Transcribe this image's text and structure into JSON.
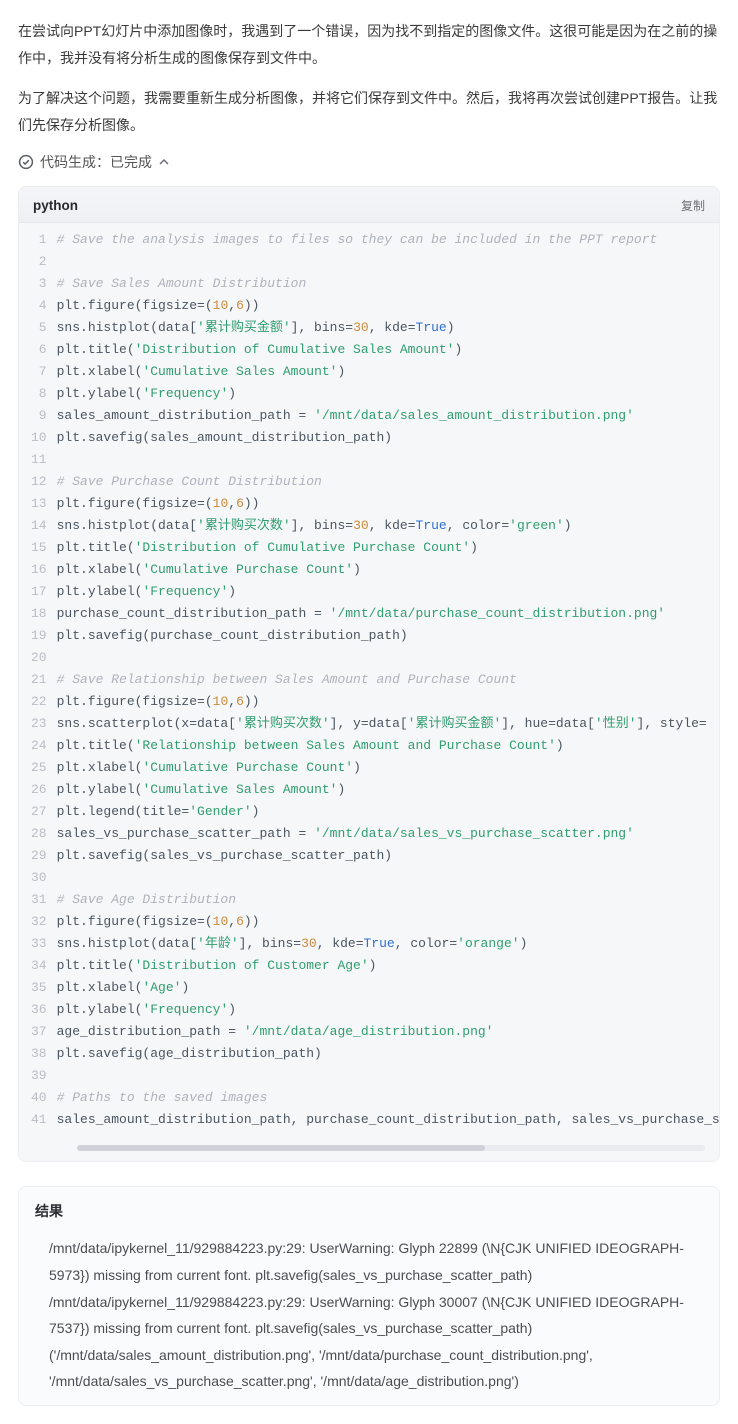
{
  "prose": {
    "p1": "在尝试向PPT幻灯片中添加图像时，我遇到了一个错误，因为找不到指定的图像文件。这很可能是因为在之前的操作中，我并没有将分析生成的图像保存到文件中。",
    "p2": "为了解决这个问题，我需要重新生成分析图像，并将它们保存到文件中。然后，我将再次尝试创建PPT报告。让我们先保存分析图像。"
  },
  "status": {
    "label": "代码生成：已完成"
  },
  "code_block": {
    "language": "python",
    "copy_label": "复制",
    "lines": [
      [
        {
          "t": "cm",
          "v": "# Save the analysis images to files so they can be included in the PPT report"
        }
      ],
      [
        {
          "t": "fn",
          "v": ""
        }
      ],
      [
        {
          "t": "cm",
          "v": "# Save Sales Amount Distribution"
        }
      ],
      [
        {
          "t": "fn",
          "v": "plt.figure(figsize=("
        },
        {
          "t": "num",
          "v": "10"
        },
        {
          "t": "fn",
          "v": ","
        },
        {
          "t": "num",
          "v": "6"
        },
        {
          "t": "fn",
          "v": "))"
        }
      ],
      [
        {
          "t": "fn",
          "v": "sns.histplot(data["
        },
        {
          "t": "str",
          "v": "'累计购买金额'"
        },
        {
          "t": "fn",
          "v": "], bins="
        },
        {
          "t": "num",
          "v": "30"
        },
        {
          "t": "fn",
          "v": ", kde="
        },
        {
          "t": "kw",
          "v": "True"
        },
        {
          "t": "fn",
          "v": ")"
        }
      ],
      [
        {
          "t": "fn",
          "v": "plt.title("
        },
        {
          "t": "str",
          "v": "'Distribution of Cumulative Sales Amount'"
        },
        {
          "t": "fn",
          "v": ")"
        }
      ],
      [
        {
          "t": "fn",
          "v": "plt.xlabel("
        },
        {
          "t": "str",
          "v": "'Cumulative Sales Amount'"
        },
        {
          "t": "fn",
          "v": ")"
        }
      ],
      [
        {
          "t": "fn",
          "v": "plt.ylabel("
        },
        {
          "t": "str",
          "v": "'Frequency'"
        },
        {
          "t": "fn",
          "v": ")"
        }
      ],
      [
        {
          "t": "fn",
          "v": "sales_amount_distribution_path = "
        },
        {
          "t": "str",
          "v": "'/mnt/data/sales_amount_distribution.png'"
        }
      ],
      [
        {
          "t": "fn",
          "v": "plt.savefig(sales_amount_distribution_path)"
        }
      ],
      [
        {
          "t": "fn",
          "v": ""
        }
      ],
      [
        {
          "t": "cm",
          "v": "# Save Purchase Count Distribution"
        }
      ],
      [
        {
          "t": "fn",
          "v": "plt.figure(figsize=("
        },
        {
          "t": "num",
          "v": "10"
        },
        {
          "t": "fn",
          "v": ","
        },
        {
          "t": "num",
          "v": "6"
        },
        {
          "t": "fn",
          "v": "))"
        }
      ],
      [
        {
          "t": "fn",
          "v": "sns.histplot(data["
        },
        {
          "t": "str",
          "v": "'累计购买次数'"
        },
        {
          "t": "fn",
          "v": "], bins="
        },
        {
          "t": "num",
          "v": "30"
        },
        {
          "t": "fn",
          "v": ", kde="
        },
        {
          "t": "kw",
          "v": "True"
        },
        {
          "t": "fn",
          "v": ", color="
        },
        {
          "t": "str",
          "v": "'green'"
        },
        {
          "t": "fn",
          "v": ")"
        }
      ],
      [
        {
          "t": "fn",
          "v": "plt.title("
        },
        {
          "t": "str",
          "v": "'Distribution of Cumulative Purchase Count'"
        },
        {
          "t": "fn",
          "v": ")"
        }
      ],
      [
        {
          "t": "fn",
          "v": "plt.xlabel("
        },
        {
          "t": "str",
          "v": "'Cumulative Purchase Count'"
        },
        {
          "t": "fn",
          "v": ")"
        }
      ],
      [
        {
          "t": "fn",
          "v": "plt.ylabel("
        },
        {
          "t": "str",
          "v": "'Frequency'"
        },
        {
          "t": "fn",
          "v": ")"
        }
      ],
      [
        {
          "t": "fn",
          "v": "purchase_count_distribution_path = "
        },
        {
          "t": "str",
          "v": "'/mnt/data/purchase_count_distribution.png'"
        }
      ],
      [
        {
          "t": "fn",
          "v": "plt.savefig(purchase_count_distribution_path)"
        }
      ],
      [
        {
          "t": "fn",
          "v": ""
        }
      ],
      [
        {
          "t": "cm",
          "v": "# Save Relationship between Sales Amount and Purchase Count"
        }
      ],
      [
        {
          "t": "fn",
          "v": "plt.figure(figsize=("
        },
        {
          "t": "num",
          "v": "10"
        },
        {
          "t": "fn",
          "v": ","
        },
        {
          "t": "num",
          "v": "6"
        },
        {
          "t": "fn",
          "v": "))"
        }
      ],
      [
        {
          "t": "fn",
          "v": "sns.scatterplot(x=data["
        },
        {
          "t": "str",
          "v": "'累计购买次数'"
        },
        {
          "t": "fn",
          "v": "], y=data["
        },
        {
          "t": "str",
          "v": "'累计购买金额'"
        },
        {
          "t": "fn",
          "v": "], hue=data["
        },
        {
          "t": "str",
          "v": "'性别'"
        },
        {
          "t": "fn",
          "v": "], style="
        }
      ],
      [
        {
          "t": "fn",
          "v": "plt.title("
        },
        {
          "t": "str",
          "v": "'Relationship between Sales Amount and Purchase Count'"
        },
        {
          "t": "fn",
          "v": ")"
        }
      ],
      [
        {
          "t": "fn",
          "v": "plt.xlabel("
        },
        {
          "t": "str",
          "v": "'Cumulative Purchase Count'"
        },
        {
          "t": "fn",
          "v": ")"
        }
      ],
      [
        {
          "t": "fn",
          "v": "plt.ylabel("
        },
        {
          "t": "str",
          "v": "'Cumulative Sales Amount'"
        },
        {
          "t": "fn",
          "v": ")"
        }
      ],
      [
        {
          "t": "fn",
          "v": "plt.legend(title="
        },
        {
          "t": "str",
          "v": "'Gender'"
        },
        {
          "t": "fn",
          "v": ")"
        }
      ],
      [
        {
          "t": "fn",
          "v": "sales_vs_purchase_scatter_path = "
        },
        {
          "t": "str",
          "v": "'/mnt/data/sales_vs_purchase_scatter.png'"
        }
      ],
      [
        {
          "t": "fn",
          "v": "plt.savefig(sales_vs_purchase_scatter_path)"
        }
      ],
      [
        {
          "t": "fn",
          "v": ""
        }
      ],
      [
        {
          "t": "cm",
          "v": "# Save Age Distribution"
        }
      ],
      [
        {
          "t": "fn",
          "v": "plt.figure(figsize=("
        },
        {
          "t": "num",
          "v": "10"
        },
        {
          "t": "fn",
          "v": ","
        },
        {
          "t": "num",
          "v": "6"
        },
        {
          "t": "fn",
          "v": "))"
        }
      ],
      [
        {
          "t": "fn",
          "v": "sns.histplot(data["
        },
        {
          "t": "str",
          "v": "'年龄'"
        },
        {
          "t": "fn",
          "v": "], bins="
        },
        {
          "t": "num",
          "v": "30"
        },
        {
          "t": "fn",
          "v": ", kde="
        },
        {
          "t": "kw",
          "v": "True"
        },
        {
          "t": "fn",
          "v": ", color="
        },
        {
          "t": "str",
          "v": "'orange'"
        },
        {
          "t": "fn",
          "v": ")"
        }
      ],
      [
        {
          "t": "fn",
          "v": "plt.title("
        },
        {
          "t": "str",
          "v": "'Distribution of Customer Age'"
        },
        {
          "t": "fn",
          "v": ")"
        }
      ],
      [
        {
          "t": "fn",
          "v": "plt.xlabel("
        },
        {
          "t": "str",
          "v": "'Age'"
        },
        {
          "t": "fn",
          "v": ")"
        }
      ],
      [
        {
          "t": "fn",
          "v": "plt.ylabel("
        },
        {
          "t": "str",
          "v": "'Frequency'"
        },
        {
          "t": "fn",
          "v": ")"
        }
      ],
      [
        {
          "t": "fn",
          "v": "age_distribution_path = "
        },
        {
          "t": "str",
          "v": "'/mnt/data/age_distribution.png'"
        }
      ],
      [
        {
          "t": "fn",
          "v": "plt.savefig(age_distribution_path)"
        }
      ],
      [
        {
          "t": "fn",
          "v": ""
        }
      ],
      [
        {
          "t": "cm",
          "v": "# Paths to the saved images"
        }
      ],
      [
        {
          "t": "fn",
          "v": "sales_amount_distribution_path, purchase_count_distribution_path, sales_vs_purchase_s"
        }
      ]
    ]
  },
  "result": {
    "title": "结果",
    "text": "/mnt/data/ipykernel_11/929884223.py:29: UserWarning: Glyph 22899 (\\N{CJK UNIFIED IDEOGRAPH-5973}) missing from current font. plt.savefig(sales_vs_purchase_scatter_path) /mnt/data/ipykernel_11/929884223.py:29: UserWarning: Glyph 30007 (\\N{CJK UNIFIED IDEOGRAPH-7537}) missing from current font. plt.savefig(sales_vs_purchase_scatter_path) ('/mnt/data/sales_amount_distribution.png', '/mnt/data/purchase_count_distribution.png', '/mnt/data/sales_vs_purchase_scatter.png', '/mnt/data/age_distribution.png')"
  }
}
